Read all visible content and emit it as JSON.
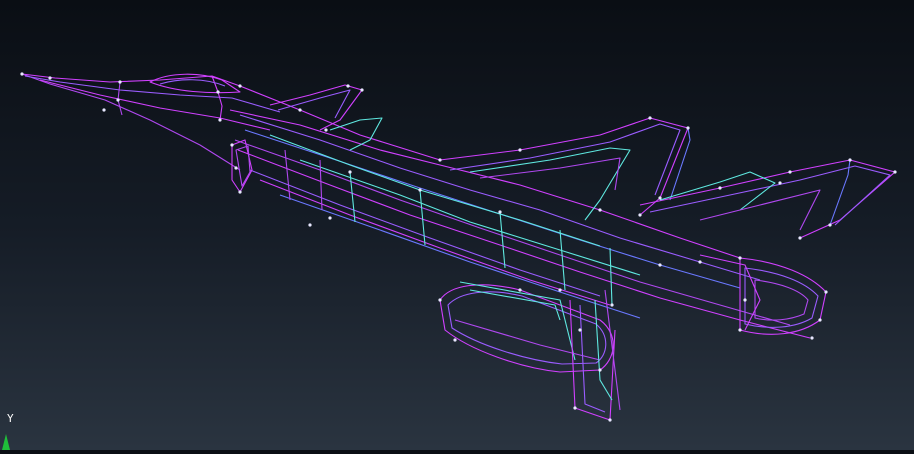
{
  "viewport": {
    "model": "wireframe-aircraft",
    "render_mode": "wireframe",
    "background": {
      "top": "#0a0e14",
      "bottom": "#2a3440"
    }
  },
  "colors": {
    "magenta": "#d040ff",
    "violet": "#9a5cff",
    "blue": "#6a78ff",
    "cyan": "#5fe8e0",
    "vertex": "#e8e8ff"
  },
  "triad": {
    "y_label": "Y",
    "y_axis_color": "#1fbf3a"
  }
}
